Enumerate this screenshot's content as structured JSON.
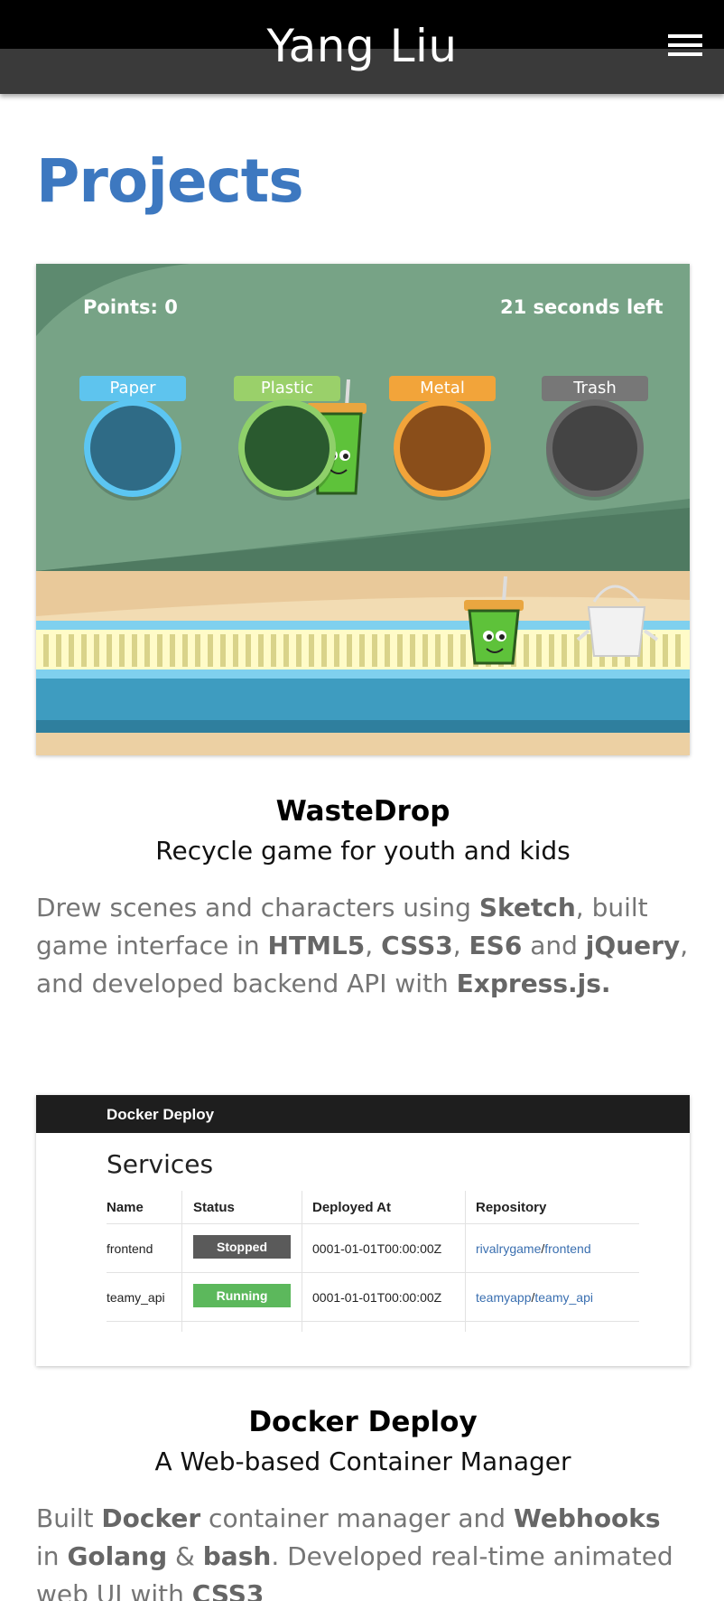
{
  "header": {
    "title": "Yang Liu",
    "menu_icon": "hamburger-menu-icon"
  },
  "page_title": "Projects",
  "projects": [
    {
      "name": "WasteDrop",
      "subtitle": "Recycle game for youth and kids",
      "description": [
        {
          "t": "Drew scenes and characters using ",
          "b": false
        },
        {
          "t": "Sketch",
          "b": true
        },
        {
          "t": ", built game interface in ",
          "b": false
        },
        {
          "t": "HTML5",
          "b": true
        },
        {
          "t": ", ",
          "b": false
        },
        {
          "t": "CSS3",
          "b": true
        },
        {
          "t": ", ",
          "b": false
        },
        {
          "t": "ES6",
          "b": true
        },
        {
          "t": " and ",
          "b": false
        },
        {
          "t": "jQuery",
          "b": true
        },
        {
          "t": ", and developed backend API with ",
          "b": false
        },
        {
          "t": "Express.js.",
          "b": true
        }
      ],
      "screenshot": {
        "points": "Points: 0",
        "time_left": "21 seconds left",
        "bins": [
          {
            "label": "Paper",
            "label_color": "#5ec4ee",
            "fill": "#2f6b86",
            "ring": "#5cc6f2"
          },
          {
            "label": "Plastic",
            "label_color": "#9ad06a",
            "fill": "#2a5a2f",
            "ring": "#8fd06a"
          },
          {
            "label": "Metal",
            "label_color": "#f2a43a",
            "fill": "#8a4e1a",
            "ring": "#f2a43a"
          },
          {
            "label": "Trash",
            "label_color": "#777777",
            "fill": "#444444",
            "ring": "#6a6a6a"
          }
        ]
      }
    },
    {
      "name": "Docker Deploy",
      "subtitle": "A Web-based Container Manager",
      "description": [
        {
          "t": "Built ",
          "b": false
        },
        {
          "t": "Docker",
          "b": true
        },
        {
          "t": " container manager and ",
          "b": false
        },
        {
          "t": "Webhooks",
          "b": true
        },
        {
          "t": " in ",
          "b": false
        },
        {
          "t": "Golang",
          "b": true
        },
        {
          "t": " & ",
          "b": false
        },
        {
          "t": "bash",
          "b": true
        },
        {
          "t": ". Developed real-time animated web UI with ",
          "b": false
        },
        {
          "t": "CSS3",
          "b": true
        }
      ],
      "screenshot": {
        "app_title": "Docker Deploy",
        "heading": "Services",
        "columns": [
          "Name",
          "Status",
          "Deployed At",
          "Repository"
        ],
        "rows": [
          {
            "name": "frontend",
            "status": "Stopped",
            "status_color": "#5a5a5a",
            "deployed_at": "0001-01-01T00:00:00Z",
            "repo_owner": "rivalrygame",
            "repo_name": "frontend"
          },
          {
            "name": "teamy_api",
            "status": "Running",
            "status_color": "#5cb85c",
            "deployed_at": "0001-01-01T00:00:00Z",
            "repo_owner": "teamyapp",
            "repo_name": "teamy_api"
          }
        ]
      }
    }
  ]
}
